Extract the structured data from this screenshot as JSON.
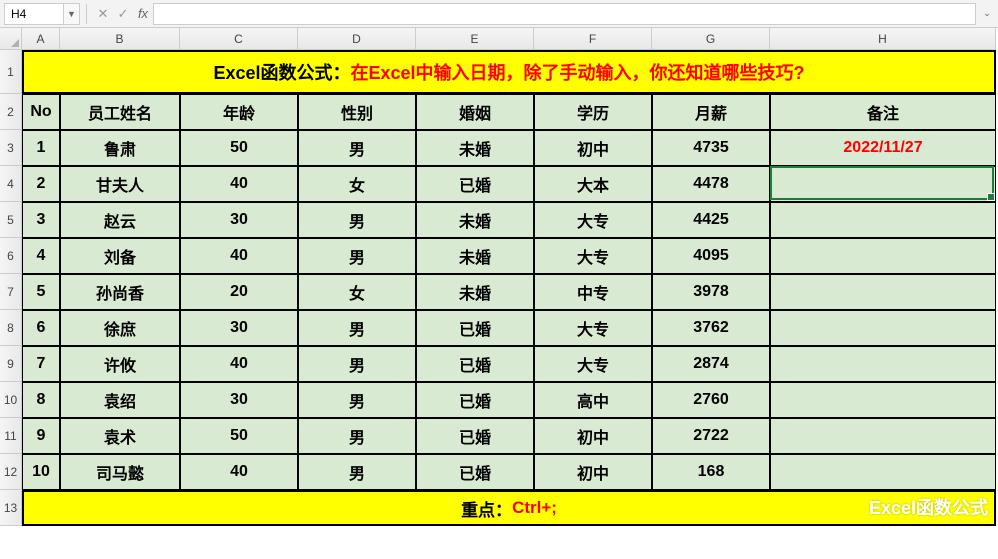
{
  "formula_bar": {
    "name_box": "H4",
    "cancel": "✕",
    "confirm": "✓",
    "fx": "fx",
    "value": ""
  },
  "columns": [
    "A",
    "B",
    "C",
    "D",
    "E",
    "F",
    "G",
    "H"
  ],
  "row_labels": [
    "1",
    "2",
    "3",
    "4",
    "5",
    "6",
    "7",
    "8",
    "9",
    "10",
    "11",
    "12",
    "13"
  ],
  "title": {
    "part1": "Excel函数公式：",
    "part2": "在Excel中输入日期，除了手动输入，你还知道哪些技巧?"
  },
  "headers": [
    "No",
    "员工姓名",
    "年龄",
    "性别",
    "婚姻",
    "学历",
    "月薪",
    "备注"
  ],
  "rows": [
    {
      "no": "1",
      "name": "鲁肃",
      "age": "50",
      "gender": "男",
      "marital": "未婚",
      "edu": "初中",
      "salary": "4735",
      "remark": "2022/11/27"
    },
    {
      "no": "2",
      "name": "甘夫人",
      "age": "40",
      "gender": "女",
      "marital": "已婚",
      "edu": "大本",
      "salary": "4478",
      "remark": ""
    },
    {
      "no": "3",
      "name": "赵云",
      "age": "30",
      "gender": "男",
      "marital": "未婚",
      "edu": "大专",
      "salary": "4425",
      "remark": ""
    },
    {
      "no": "4",
      "name": "刘备",
      "age": "40",
      "gender": "男",
      "marital": "未婚",
      "edu": "大专",
      "salary": "4095",
      "remark": ""
    },
    {
      "no": "5",
      "name": "孙尚香",
      "age": "20",
      "gender": "女",
      "marital": "未婚",
      "edu": "中专",
      "salary": "3978",
      "remark": ""
    },
    {
      "no": "6",
      "name": "徐庶",
      "age": "30",
      "gender": "男",
      "marital": "已婚",
      "edu": "大专",
      "salary": "3762",
      "remark": ""
    },
    {
      "no": "7",
      "name": "许攸",
      "age": "40",
      "gender": "男",
      "marital": "已婚",
      "edu": "大专",
      "salary": "2874",
      "remark": ""
    },
    {
      "no": "8",
      "name": "袁绍",
      "age": "30",
      "gender": "男",
      "marital": "已婚",
      "edu": "高中",
      "salary": "2760",
      "remark": ""
    },
    {
      "no": "9",
      "name": "袁术",
      "age": "50",
      "gender": "男",
      "marital": "已婚",
      "edu": "初中",
      "salary": "2722",
      "remark": ""
    },
    {
      "no": "10",
      "name": "司马懿",
      "age": "40",
      "gender": "男",
      "marital": "已婚",
      "edu": "初中",
      "salary": "168",
      "remark": ""
    }
  ],
  "footer": {
    "part1": "重点：",
    "part2": "Ctrl+;"
  },
  "watermark": "Excel函数公式",
  "active_cell": "H4"
}
